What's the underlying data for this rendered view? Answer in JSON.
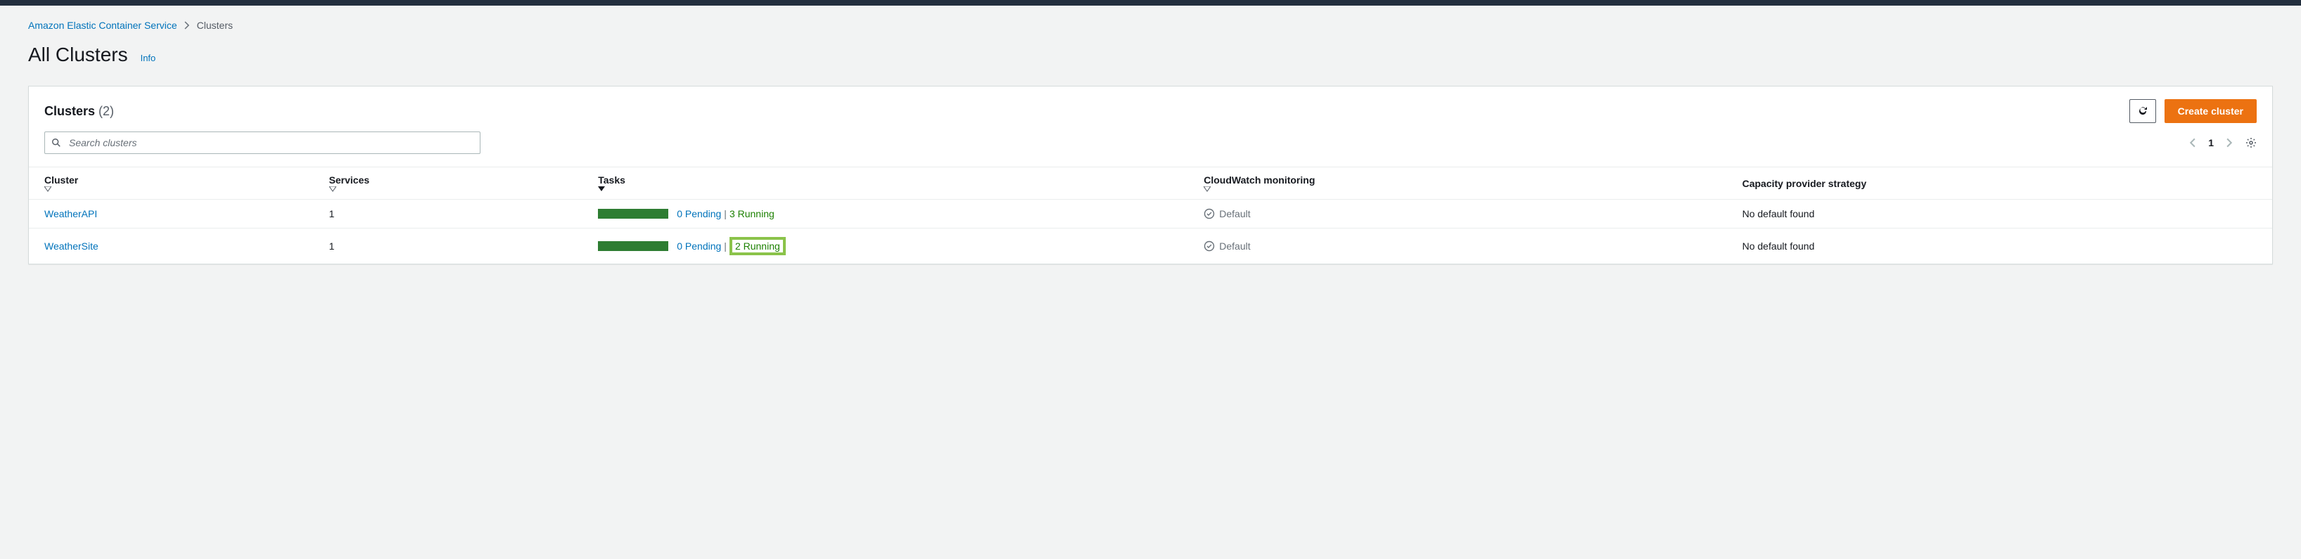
{
  "breadcrumb": {
    "root": "Amazon Elastic Container Service",
    "current": "Clusters"
  },
  "page": {
    "title": "All Clusters",
    "info_label": "Info"
  },
  "panel": {
    "title": "Clusters",
    "count": "(2)",
    "create_button": "Create cluster",
    "search_placeholder": "Search clusters"
  },
  "pagination": {
    "page": "1"
  },
  "columns": {
    "cluster": "Cluster",
    "services": "Services",
    "tasks": "Tasks",
    "monitoring": "CloudWatch monitoring",
    "capacity": "Capacity provider strategy"
  },
  "rows": [
    {
      "name": "WeatherAPI",
      "services": "1",
      "pending": "0 Pending",
      "running": "3 Running",
      "monitoring": "Default",
      "capacity": "No default found",
      "highlight_running": false
    },
    {
      "name": "WeatherSite",
      "services": "1",
      "pending": "0 Pending",
      "running": "2 Running",
      "monitoring": "Default",
      "capacity": "No default found",
      "highlight_running": true
    }
  ]
}
